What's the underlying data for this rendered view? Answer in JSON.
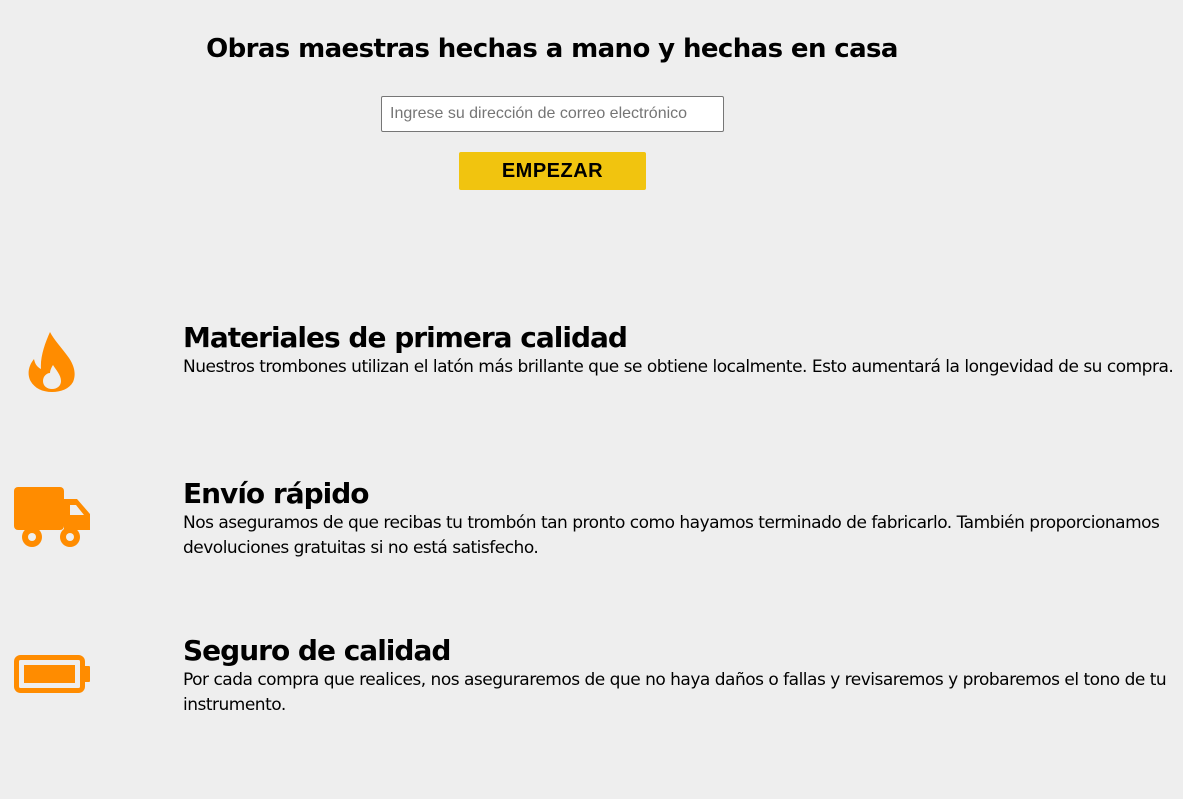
{
  "hero": {
    "title": "Obras maestras hechas a mano y hechas en casa",
    "email_placeholder": "Ingrese su dirección de correo electrónico",
    "email_value": "",
    "start_label": "EMPEZAR"
  },
  "colors": {
    "background": "#eeeeee",
    "accent_button": "#f1c40f",
    "icon": "#ff8c00"
  },
  "features": [
    {
      "icon": "fire-icon",
      "title": "Materiales de primera calidad",
      "description": "Nuestros trombones utilizan el latón más brillante que se obtiene localmente. Esto aumentará la longevidad de su compra."
    },
    {
      "icon": "truck-icon",
      "title": "Envío rápido",
      "description": "Nos aseguramos de que recibas tu trombón tan pronto como hayamos terminado de fabricarlo. También proporcionamos devoluciones gratuitas si no está satisfecho."
    },
    {
      "icon": "battery-full-icon",
      "title": "Seguro de calidad",
      "description": "Por cada compra que realices, nos aseguraremos de que no haya daños o fallas y revisaremos y probaremos el tono de tu instrumento."
    }
  ]
}
